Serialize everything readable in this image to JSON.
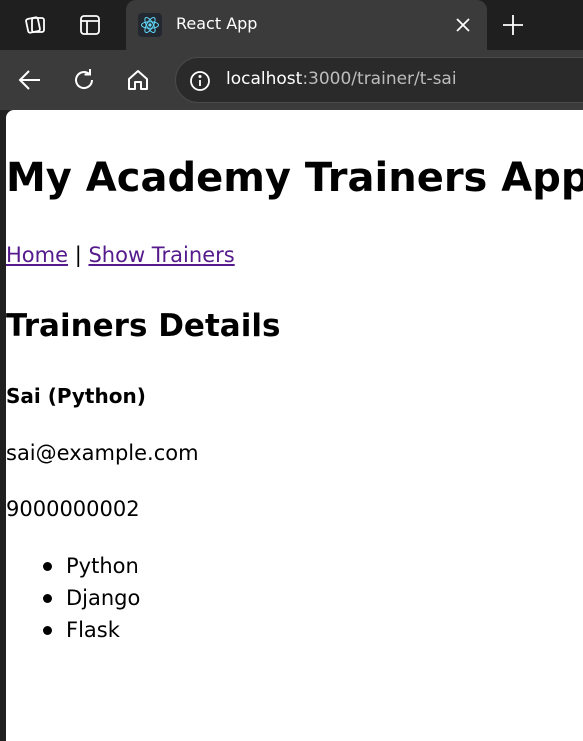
{
  "browser": {
    "tab": {
      "title": "React App",
      "favicon": "react-logo-icon"
    },
    "address": {
      "host": "localhost",
      "path": ":3000/trainer/t-sai"
    },
    "icons": {
      "workspaces": "workspaces-icon",
      "tab_actions": "tab-actions-icon",
      "close": "close-icon",
      "new_tab": "plus-icon",
      "back": "back-arrow-icon",
      "reload": "reload-icon",
      "home": "home-icon",
      "site_info": "info-icon"
    },
    "colors": {
      "frame": "#1f1f1f",
      "tab_active": "#3b3b3b",
      "link_visited": "#551a8b",
      "react_blue": "#61dafb"
    }
  },
  "page": {
    "title": "My Academy Trainers App",
    "nav": {
      "home": "Home",
      "separator": "|",
      "show_trainers": "Show Trainers"
    },
    "section_title": "Trainers Details",
    "trainer": {
      "name": "Sai (Python)",
      "email": "sai@example.com",
      "phone": "9000000002",
      "skills": [
        "Python",
        "Django",
        "Flask"
      ]
    }
  }
}
